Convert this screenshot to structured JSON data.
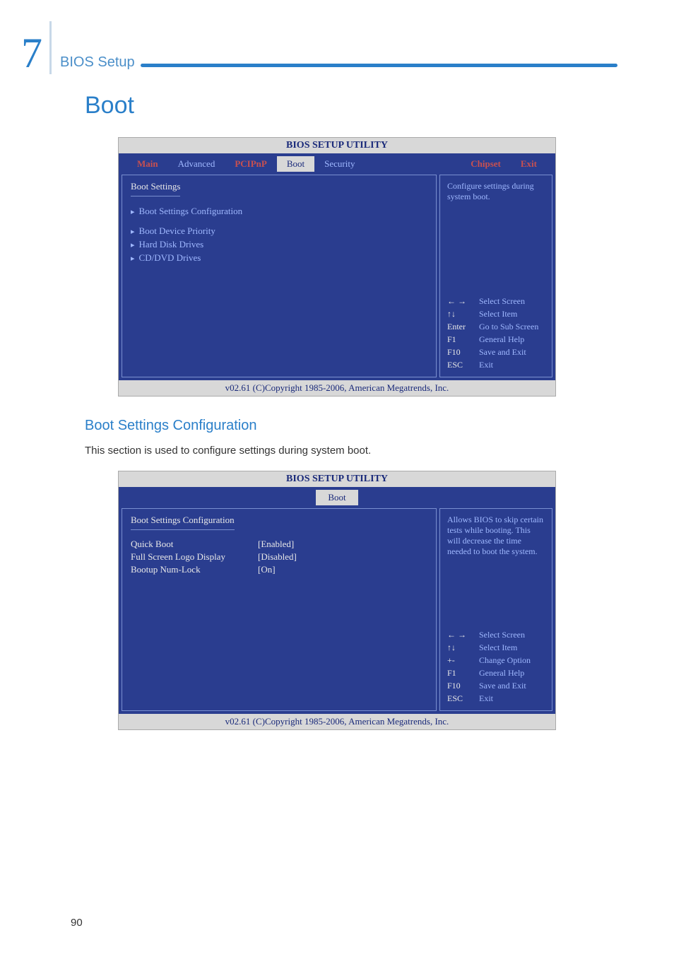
{
  "chapter": {
    "number": "7",
    "title": "BIOS Setup"
  },
  "heading1": "Boot",
  "heading2": "Boot Settings Configuration",
  "body_text": "This section is used to configure settings during system boot.",
  "page_number": "90",
  "bios1": {
    "title": "BIOS SETUP UTILITY",
    "tabs": {
      "main": "Main",
      "advanced": "Advanced",
      "pcipnp": "PCIPnP",
      "boot": "Boot",
      "security": "Security",
      "chipset": "Chipset",
      "exit": "Exit"
    },
    "left": {
      "section": "Boot Settings",
      "items": {
        "bsc": "Boot Settings Configuration",
        "bdp": "Boot Device Priority",
        "hdd": "Hard Disk Drives",
        "cd": "CD/DVD Drives"
      }
    },
    "right": {
      "help": "Configure settings during system boot.",
      "keys": {
        "lr": "← →",
        "ud": "↑↓",
        "enter": "Enter",
        "f1": "F1",
        "f10": "F10",
        "esc": "ESC"
      },
      "actions": {
        "ss": "Select Screen",
        "si": "Select Item",
        "sub": "Go to Sub Screen",
        "gh": "General Help",
        "se": "Save and Exit",
        "ex": "Exit"
      }
    },
    "footer": "v02.61 (C)Copyright 1985-2006, American Megatrends, Inc."
  },
  "bios2": {
    "title": "BIOS SETUP UTILITY",
    "tab": "Boot",
    "left": {
      "section": "Boot Settings Configuration",
      "settings": {
        "qb": {
          "label": "Quick Boot",
          "value": "[Enabled]"
        },
        "fs": {
          "label": "Full Screen Logo Display",
          "value": "[Disabled]"
        },
        "nl": {
          "label": "Bootup Num-Lock",
          "value": "[On]"
        }
      }
    },
    "right": {
      "help": "Allows BIOS to skip certain tests while booting. This will decrease the time needed to boot the system.",
      "keys": {
        "lr": "← →",
        "ud": "↑↓",
        "pm": "+-",
        "f1": "F1",
        "f10": "F10",
        "esc": "ESC"
      },
      "actions": {
        "ss": "Select Screen",
        "si": "Select Item",
        "co": "Change Option",
        "gh": "General Help",
        "se": "Save and Exit",
        "ex": "Exit"
      }
    },
    "footer": "v02.61 (C)Copyright 1985-2006, American Megatrends, Inc."
  }
}
